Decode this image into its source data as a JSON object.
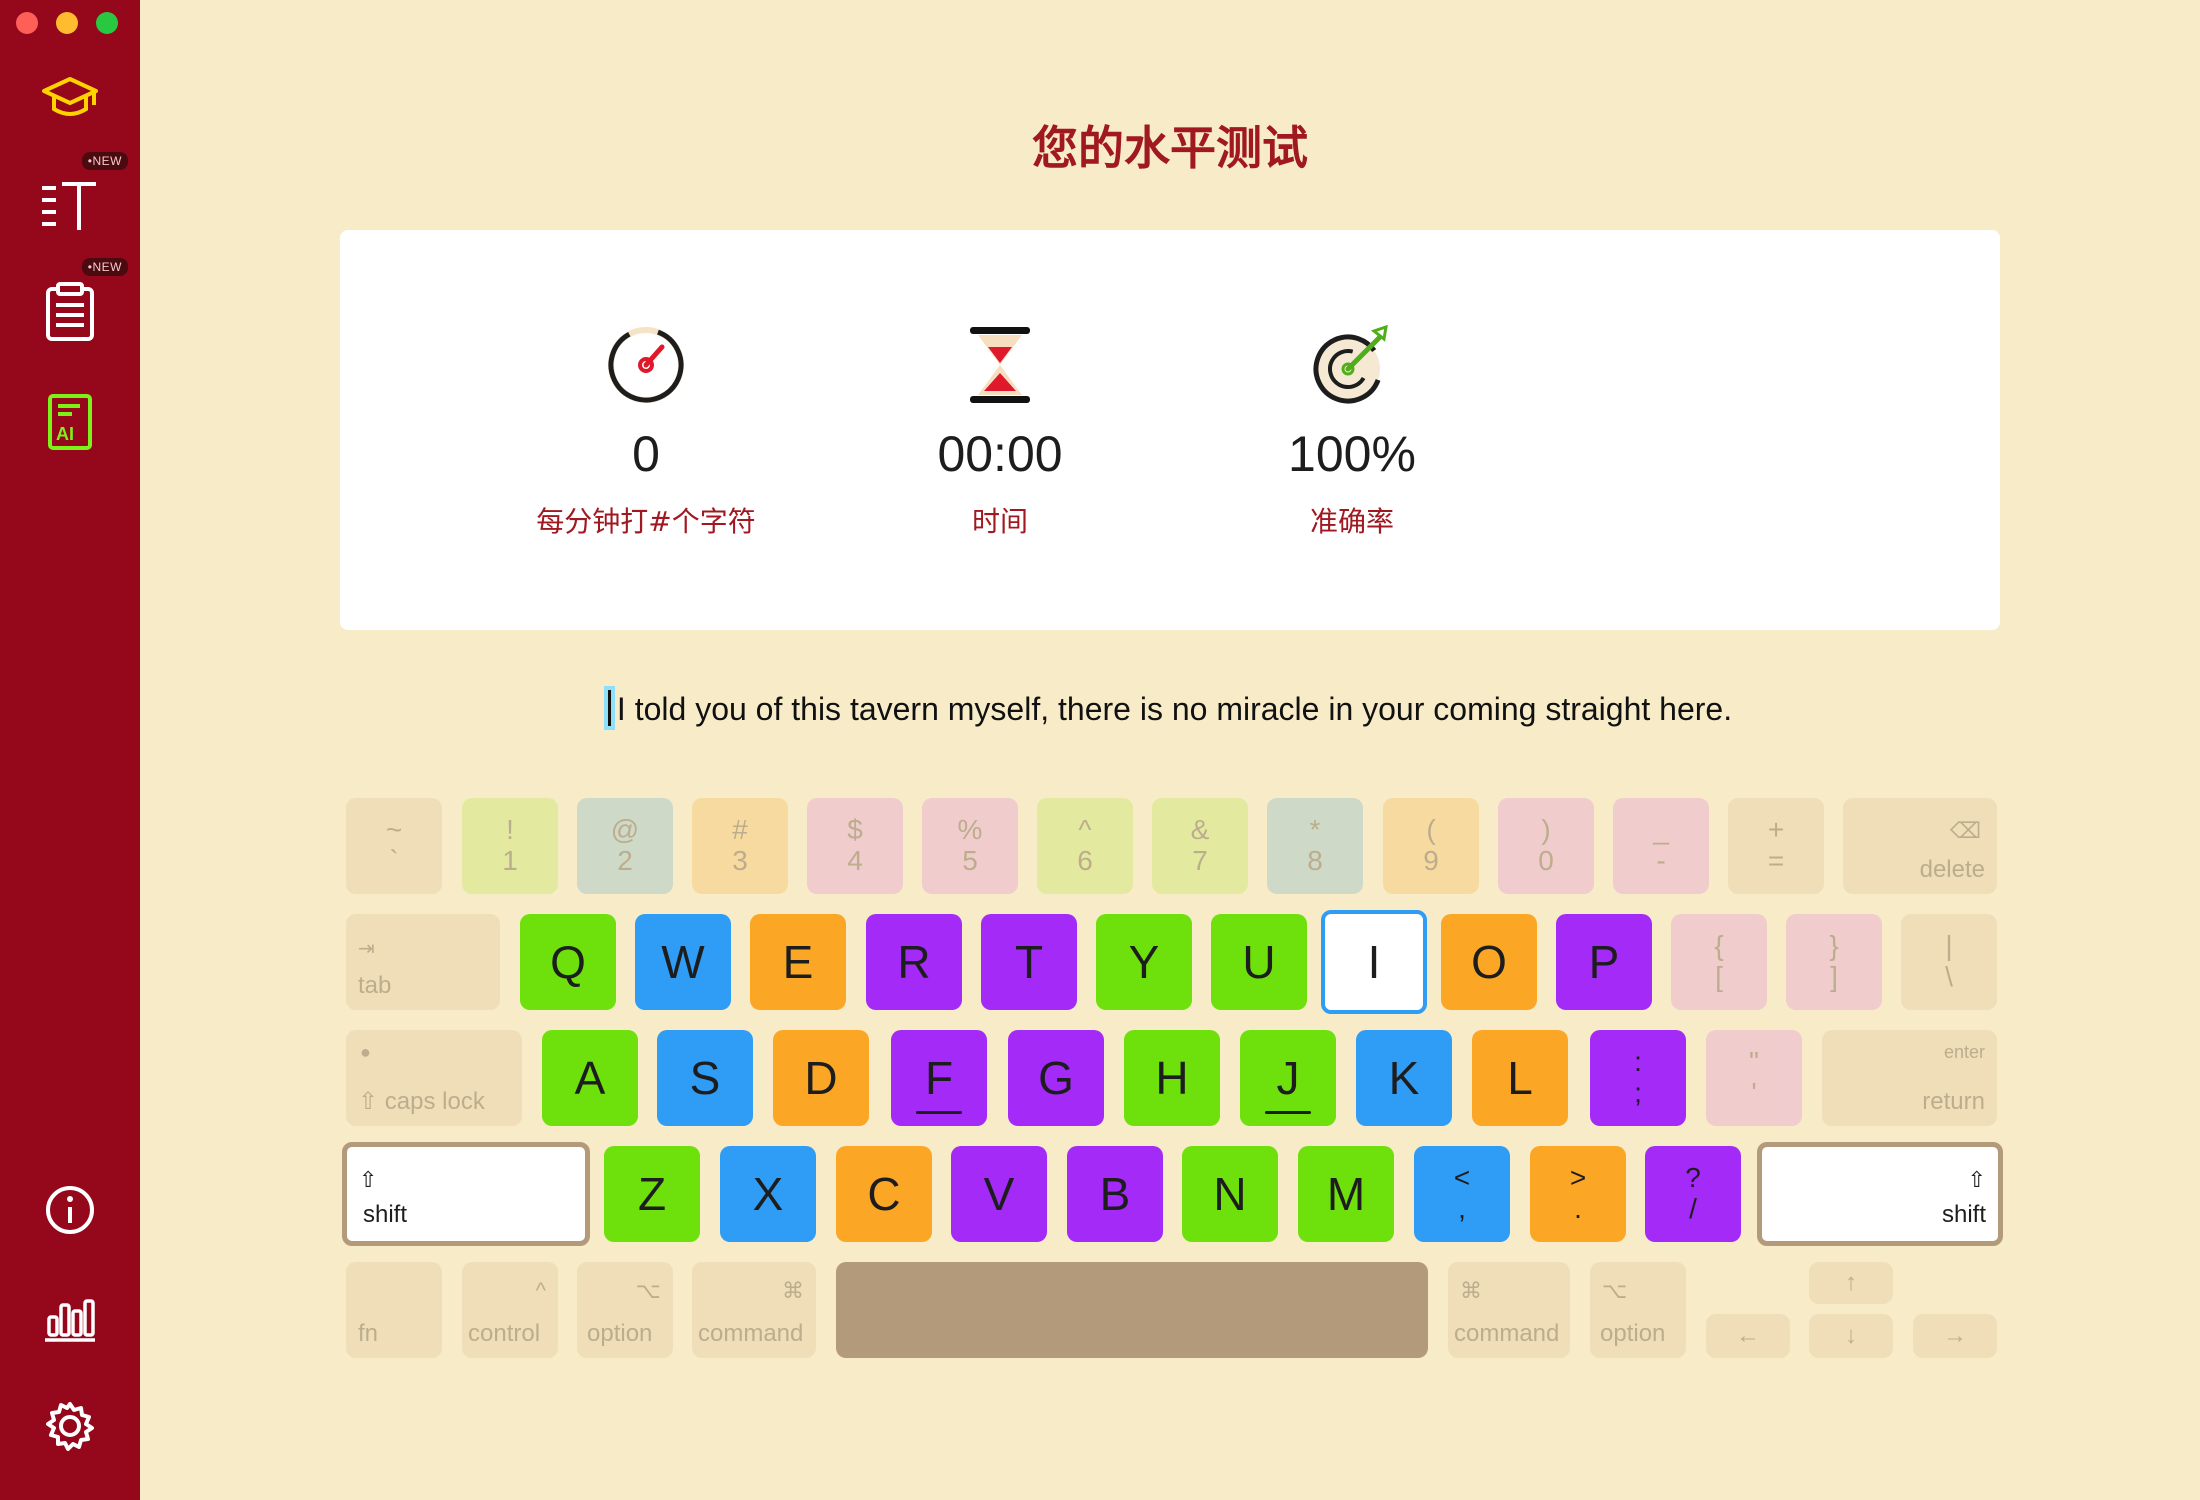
{
  "window": {
    "title": "您的水平测试"
  },
  "sidebar": {
    "new_badge": "•NEW",
    "items": [
      {
        "icon": "graduation-cap-icon"
      },
      {
        "icon": "text-lines-icon",
        "badge": "•NEW"
      },
      {
        "icon": "clipboard-list-icon",
        "badge": "•NEW"
      },
      {
        "icon": "ai-document-icon"
      },
      {
        "icon": "info-icon"
      },
      {
        "icon": "bar-chart-icon"
      },
      {
        "icon": "gear-icon"
      }
    ]
  },
  "stats": {
    "speed": {
      "value": "0",
      "label": "每分钟打#个字符",
      "icon": "speedometer-icon"
    },
    "time": {
      "value": "00:00",
      "label": "时间",
      "icon": "hourglass-icon"
    },
    "accuracy": {
      "value": "100%",
      "label": "准确率",
      "icon": "target-icon"
    }
  },
  "prompt": {
    "current_char": "I",
    "text": " told you of this tavern myself, there is no miracle in your coming straight here."
  },
  "keyboard": {
    "number_row": [
      {
        "top": "~",
        "bottom": "`"
      },
      {
        "top": "!",
        "bottom": "1"
      },
      {
        "top": "@",
        "bottom": "2"
      },
      {
        "top": "#",
        "bottom": "3"
      },
      {
        "top": "$",
        "bottom": "4"
      },
      {
        "top": "%",
        "bottom": "5"
      },
      {
        "top": "^",
        "bottom": "6"
      },
      {
        "top": "&",
        "bottom": "7"
      },
      {
        "top": "*",
        "bottom": "8"
      },
      {
        "top": "(",
        "bottom": "9"
      },
      {
        "top": ")",
        "bottom": "0"
      },
      {
        "top": "_",
        "bottom": "-"
      },
      {
        "top": "+",
        "bottom": "="
      }
    ],
    "delete_label": "delete",
    "tab_label": "tab",
    "tab_glyph": "⇥",
    "q_row": [
      "Q",
      "W",
      "E",
      "R",
      "T",
      "Y",
      "U",
      "I",
      "O",
      "P"
    ],
    "brackets": [
      {
        "top": "{",
        "bottom": "["
      },
      {
        "top": "}",
        "bottom": "]"
      },
      {
        "top": "|",
        "bottom": "\\"
      }
    ],
    "caps_label": "caps lock",
    "a_row": [
      "A",
      "S",
      "D",
      "F",
      "G",
      "H",
      "J",
      "K",
      "L"
    ],
    "semicolon": {
      "top": ":",
      "bottom": ";"
    },
    "quote": {
      "top": "\"",
      "bottom": "'"
    },
    "enter_label": "enter",
    "return_label": "return",
    "shift_label": "shift",
    "shift_glyph": "⇧",
    "z_row": [
      "Z",
      "X",
      "C",
      "V",
      "B",
      "N",
      "M"
    ],
    "punct": [
      {
        "top": "<",
        "bottom": ","
      },
      {
        "top": ">",
        "bottom": "."
      },
      {
        "top": "?",
        "bottom": "/"
      }
    ],
    "fn_label": "fn",
    "control_label": "control",
    "control_glyph": "^",
    "option_label": "option",
    "option_glyph": "⌥",
    "command_label": "command",
    "command_glyph": "⌘",
    "arrows": {
      "up": "↑",
      "down": "↓",
      "left": "←",
      "right": "→"
    },
    "delete_glyph": "⌫",
    "active_key": "I"
  },
  "colors": {
    "sidebar": "#95071a",
    "background": "#f8ebc8",
    "accent_red": "#a01820",
    "lime": "#6ee00b",
    "blue": "#2f9cf5",
    "orange": "#fca626",
    "purple": "#a32af7"
  }
}
